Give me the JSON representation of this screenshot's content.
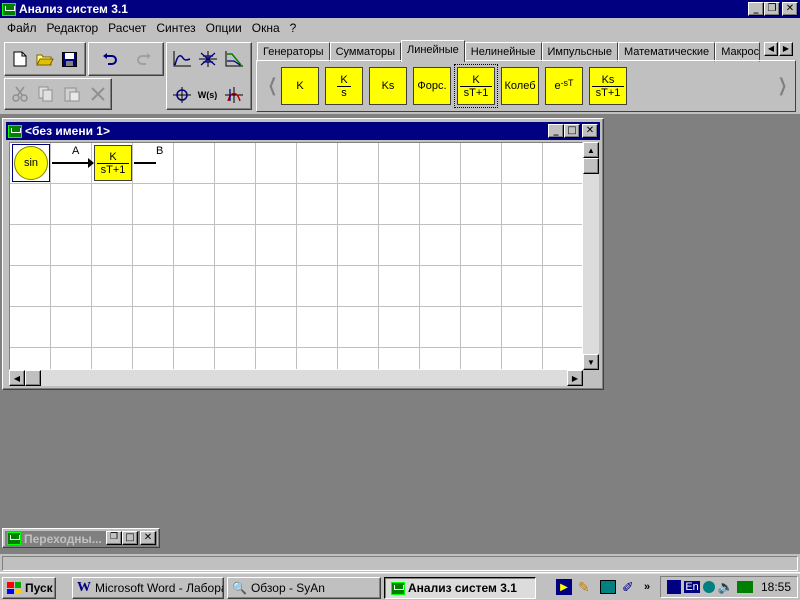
{
  "app": {
    "title": "Анализ систем 3.1",
    "window_controls": {
      "minimize": "_",
      "restore": "❐",
      "close": "✕"
    }
  },
  "menu": [
    "Файл",
    "Редактор",
    "Расчет",
    "Синтез",
    "Опции",
    "Окна",
    "?"
  ],
  "toolbar": {
    "icons": [
      "new-file-icon",
      "open-folder-icon",
      "save-icon",
      "undo-icon",
      "redo-icon",
      "cut-icon",
      "copy-icon",
      "paste-icon",
      "delete-icon",
      "time-response-icon",
      "root-locus-icon",
      "frequency-response-icon",
      "nyquist-icon",
      "transfer-function-icon",
      "bode-icon"
    ],
    "wfs_label": "W(s)"
  },
  "tabs": {
    "items": [
      "Генераторы",
      "Сумматоры",
      "Линейные",
      "Нелинейные",
      "Импульсные",
      "Математические",
      "Макрос"
    ],
    "active": "Линейные"
  },
  "palette": {
    "blocks": [
      {
        "top": "K",
        "bottom": ""
      },
      {
        "top": "K",
        "bottom": "s"
      },
      {
        "top": "Ks",
        "bottom": ""
      },
      {
        "top": "Форс.",
        "bottom": ""
      },
      {
        "top": "K",
        "bottom": "sT+1"
      },
      {
        "top": "Колеб",
        "bottom": ""
      },
      {
        "top": "e",
        "sup": "-sT",
        "bottom": ""
      },
      {
        "top": "Ks",
        "bottom": "sT+1"
      }
    ],
    "scroll_left": "◀",
    "scroll_right": "▶"
  },
  "document": {
    "title": "<без имени 1>",
    "diagram": {
      "source_label": "sin",
      "block_numerator": "K",
      "block_denominator": "sT+1",
      "signal_a": "A",
      "signal_b": "B"
    }
  },
  "minimized_window": {
    "title": "Переходны..."
  },
  "taskbar": {
    "start": "Пуск",
    "tasks": [
      "Microsoft Word - Лабора...",
      "Обзор - SyAn",
      "Анализ систем 3.1"
    ],
    "active_task": "Анализ систем 3.1",
    "language": "En",
    "clock": "18:55",
    "quicklaunch_chevron": "»"
  },
  "colors": {
    "titlebar": "#000080",
    "desktop_mdi": "#808080",
    "block_fill": "#ffff00",
    "grid_line": "#c0c0c0"
  }
}
